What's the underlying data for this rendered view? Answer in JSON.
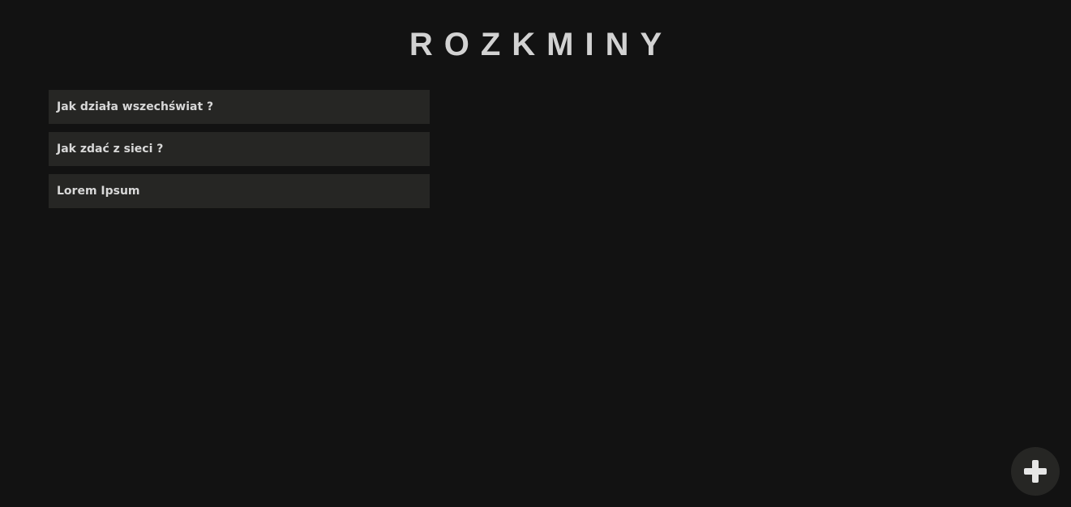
{
  "header": {
    "title": "ROZKMINY"
  },
  "topics": [
    {
      "label": "Jak działa wszechświat ?"
    },
    {
      "label": "Jak zdać z sieci ?"
    },
    {
      "label": "Lorem Ipsum"
    }
  ],
  "fab": {
    "icon": "plus-icon"
  },
  "colors": {
    "background": "#121212",
    "card": "#262624",
    "text": "#d6d6d6"
  }
}
